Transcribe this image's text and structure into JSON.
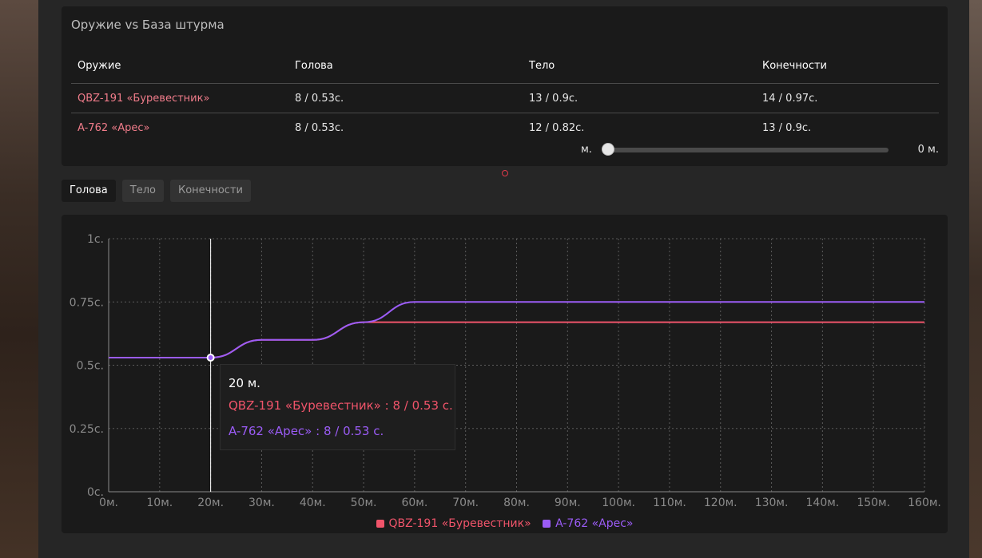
{
  "table_panel": {
    "title": "Оружие vs База штурма",
    "headers": [
      "Оружие",
      "Голова",
      "Тело",
      "Конечности"
    ],
    "rows": [
      {
        "weapon": "QBZ-191 «Буревестник»",
        "head": "8 / 0.53с.",
        "body": "13 / 0.9с.",
        "limbs": "14 / 0.97с."
      },
      {
        "weapon": "A-762 «Арес»",
        "head": "8 / 0.53с.",
        "body": "12 / 0.82с.",
        "limbs": "13 / 0.9с."
      }
    ],
    "slider": {
      "unit_label": "м.",
      "value_label": "0 м.",
      "value": 0,
      "min": 0,
      "max": 160
    }
  },
  "tabs": [
    {
      "label": "Голова",
      "active": true
    },
    {
      "label": "Тело",
      "active": false
    },
    {
      "label": "Конечности",
      "active": false
    }
  ],
  "tooltip": {
    "title": "20 м.",
    "line1": "QBZ-191 «Буревестник» : 8 / 0.53 с.",
    "line2": "A-762 «Арес» : 8 / 0.53 с."
  },
  "colors": {
    "series1": "#f0546a",
    "series2": "#9b5cf6",
    "weapon_link": "#f07c8a"
  },
  "chart_data": {
    "type": "line",
    "x": [
      0,
      20,
      30,
      40,
      50,
      60,
      70,
      80,
      90,
      100,
      110,
      120,
      130,
      140,
      150,
      160
    ],
    "series": [
      {
        "name": "QBZ-191 «Буревестник»",
        "values": [
          0.53,
          0.53,
          0.6,
          0.6,
          0.67,
          0.67,
          0.67,
          0.67,
          0.67,
          0.67,
          0.67,
          0.67,
          0.67,
          0.67,
          0.67,
          0.67
        ]
      },
      {
        "name": "A-762 «Арес»",
        "values": [
          0.53,
          0.53,
          0.6,
          0.6,
          0.67,
          0.75,
          0.75,
          0.75,
          0.75,
          0.75,
          0.75,
          0.75,
          0.75,
          0.75,
          0.75,
          0.75
        ]
      }
    ],
    "x_ticks": [
      0,
      10,
      20,
      30,
      40,
      50,
      60,
      70,
      80,
      90,
      100,
      110,
      120,
      130,
      140,
      150,
      160
    ],
    "x_tick_labels": [
      "0м.",
      "10м.",
      "20м.",
      "30м.",
      "40м.",
      "50м.",
      "60м.",
      "70м.",
      "80м.",
      "90м.",
      "100м.",
      "110м.",
      "120м.",
      "130м.",
      "140м.",
      "150м.",
      "160м."
    ],
    "y_ticks": [
      0,
      0.25,
      0.5,
      0.75,
      1
    ],
    "y_tick_labels": [
      "0с.",
      "0.25с.",
      "0.5с.",
      "0.75с.",
      "1с."
    ],
    "xlim": [
      0,
      160
    ],
    "ylim": [
      0,
      1
    ],
    "grid": true,
    "legend": "bottom-center",
    "hover_x": 20,
    "hover_y": 0.53
  }
}
